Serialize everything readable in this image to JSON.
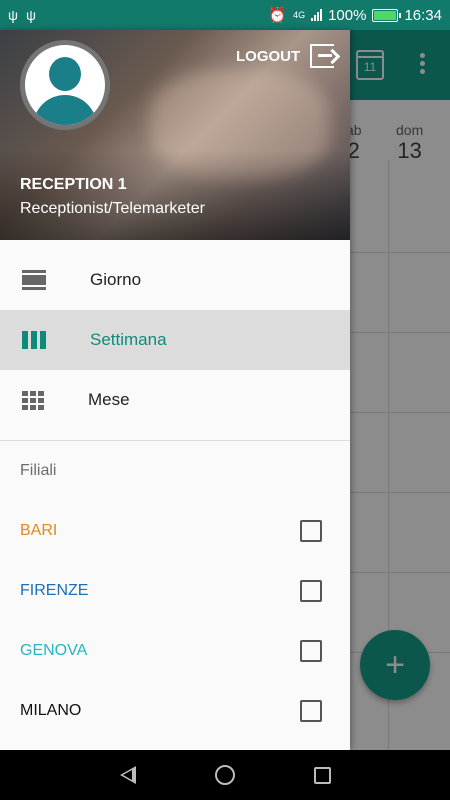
{
  "status_bar": {
    "network": "4G",
    "battery": "100%",
    "battery_level": 1.0,
    "time": "16:34"
  },
  "background": {
    "calendar_day": "11",
    "days": [
      {
        "label": "ab",
        "number": "2"
      },
      {
        "label": "dom",
        "number": "13"
      }
    ],
    "fab_label": "+"
  },
  "drawer": {
    "logout_label": "LOGOUT",
    "user_name": "RECEPTION 1",
    "user_role": "Receptionist/Telemarketer",
    "menu": [
      {
        "label": "Giorno",
        "icon": "day-view-icon",
        "active": false
      },
      {
        "label": "Settimana",
        "icon": "week-view-icon",
        "active": true
      },
      {
        "label": "Mese",
        "icon": "month-view-icon",
        "active": false
      }
    ],
    "branches_title": "Filiali",
    "branches": [
      {
        "name": "BARI",
        "color": "#e08a1e",
        "checked": false
      },
      {
        "name": "FIRENZE",
        "color": "#1f6fb5",
        "checked": false
      },
      {
        "name": "GENOVA",
        "color": "#23b7c4",
        "checked": false
      },
      {
        "name": "MILANO",
        "color": "#111111",
        "checked": false
      }
    ]
  },
  "colors": {
    "primary": "#169e8a",
    "status_bar": "#117a6b",
    "active_item": "#0f8a7a",
    "active_bg": "#dcdcdc"
  }
}
